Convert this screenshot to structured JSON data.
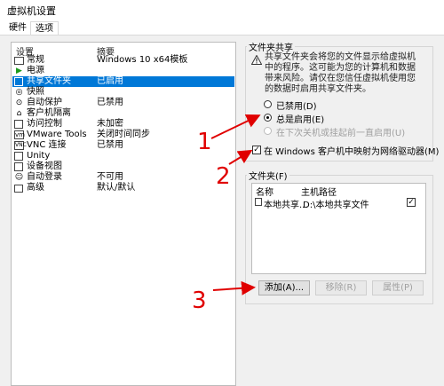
{
  "window": {
    "title": "虚拟机设置"
  },
  "tabs": [
    {
      "label": "硬件"
    },
    {
      "label": "选项"
    }
  ],
  "settings_list": {
    "col_setting": "设置",
    "col_summary": "摘要",
    "items": [
      {
        "name": "常规",
        "summary": "Windows 10 x64模板",
        "icon": "general-icon"
      },
      {
        "name": "电源",
        "summary": "",
        "icon": "power-icon"
      },
      {
        "name": "共享文件夹",
        "summary": "已启用",
        "icon": "shared-folder-icon",
        "selected": true
      },
      {
        "name": "快照",
        "summary": "",
        "icon": "snapshot-icon"
      },
      {
        "name": "自动保护",
        "summary": "已禁用",
        "icon": "autoprotect-icon"
      },
      {
        "name": "客户机隔离",
        "summary": "",
        "icon": "isolation-icon"
      },
      {
        "name": "访问控制",
        "summary": "未加密",
        "icon": "access-control-icon"
      },
      {
        "name": "VMware Tools",
        "summary": "关闭时间同步",
        "icon": "vmware-tools-icon"
      },
      {
        "name": "VNC 连接",
        "summary": "已禁用",
        "icon": "vnc-icon"
      },
      {
        "name": "Unity",
        "summary": "",
        "icon": "unity-icon"
      },
      {
        "name": "设备视图",
        "summary": "",
        "icon": "device-view-icon"
      },
      {
        "name": "自动登录",
        "summary": "不可用",
        "icon": "autologin-icon"
      },
      {
        "name": "高级",
        "summary": "默认/默认",
        "icon": "advanced-icon"
      }
    ]
  },
  "folder_sharing": {
    "group_label": "文件夹共享",
    "warning_lines": [
      "共享文件夹会将您的文件显示给虚拟机",
      "中的程序。这可能为您的计算机和数据",
      "带来风险。请仅在您信任虚拟机使用您",
      "的数据时启用共享文件夹。"
    ],
    "options": [
      {
        "label": "已禁用(D)",
        "checked": false,
        "disabled": false
      },
      {
        "label": "总是启用(E)",
        "checked": true,
        "disabled": false
      },
      {
        "label": "在下次关机或挂起前一直启用(U)",
        "checked": false,
        "disabled": true
      }
    ],
    "map_drive": {
      "label": "在 Windows 客户机中映射为网络驱动器(M)",
      "checked": true
    }
  },
  "folders": {
    "group_label": "文件夹(F)",
    "col_name": "名称",
    "col_path": "主机路径",
    "rows": [
      {
        "name": "本地共享...",
        "path": "D:\\本地共享文件",
        "checked": true
      }
    ],
    "buttons": {
      "add": "添加(A)...",
      "remove": "移除(R)",
      "properties": "属性(P)"
    }
  },
  "annotations": [
    "1",
    "2",
    "3"
  ],
  "colors": {
    "selection": "#0078d7",
    "annotation": "#e00000"
  }
}
